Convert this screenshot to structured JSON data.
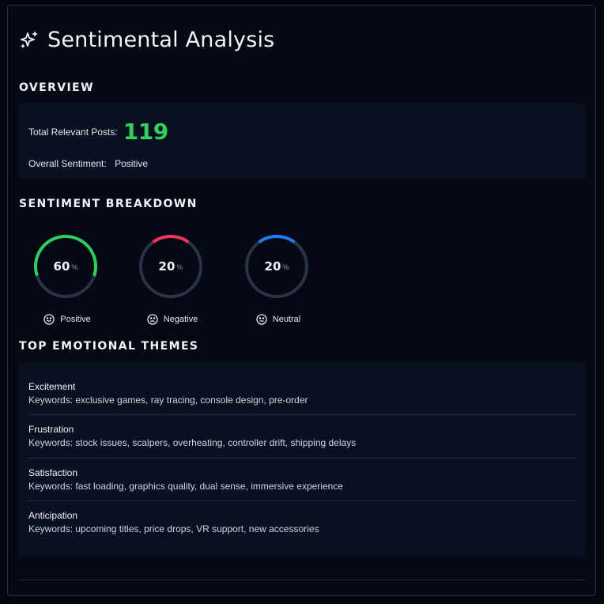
{
  "header": {
    "title": "Sentimental Analysis",
    "icon": "sparkles-icon"
  },
  "overview": {
    "heading": "OVERVIEW",
    "total_label": "Total Relevant Posts:",
    "total_value": "119",
    "sentiment_label": "Overall Sentiment:",
    "sentiment_value": "Positive",
    "accent": "#34d05e"
  },
  "breakdown": {
    "heading": "SENTIMENT BREAKDOWN",
    "items": [
      {
        "value": "60",
        "unit": "%",
        "label": "Positive",
        "percent": 60,
        "color": "#2ecf5f",
        "icon": "smile-icon"
      },
      {
        "value": "20",
        "unit": "%",
        "label": "Negative",
        "percent": 20,
        "color": "#f0355c",
        "icon": "frown-icon"
      },
      {
        "value": "20",
        "unit": "%",
        "label": "Neutral",
        "percent": 20,
        "color": "#1e7bf5",
        "icon": "neutral-face-icon"
      }
    ],
    "track_color": "#2b3446"
  },
  "themes": {
    "heading": "TOP EMOTIONAL THEMES",
    "items": [
      {
        "name": "Excitement",
        "keywords": "Keywords: exclusive games, ray tracing, console design, pre-order"
      },
      {
        "name": "Frustration",
        "keywords": "Keywords: stock issues, scalpers, overheating, controller drift, shipping delays"
      },
      {
        "name": "Satisfaction",
        "keywords": "Keywords: fast loading, graphics quality, dual sense, immersive experience"
      },
      {
        "name": "Anticipation",
        "keywords": "Keywords: upcoming titles, price drops, VR support, new accessories"
      }
    ]
  }
}
